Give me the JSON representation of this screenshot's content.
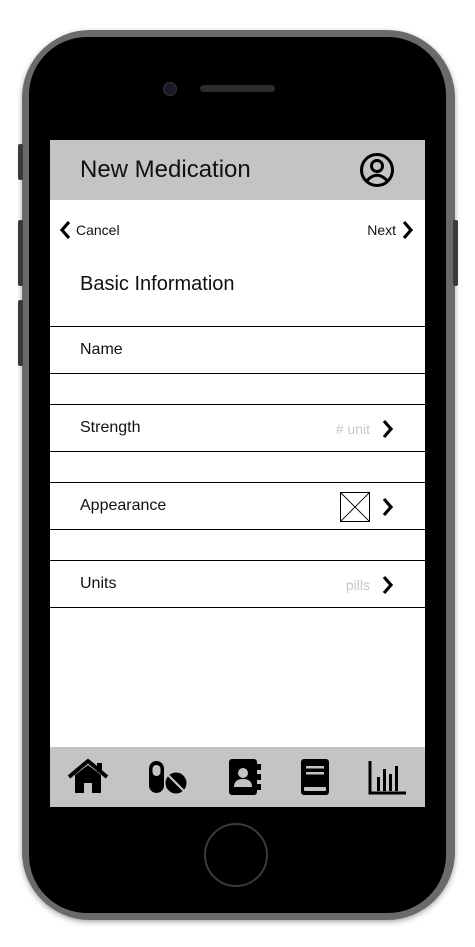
{
  "header": {
    "title": "New Medication",
    "profile_icon": "user-circle-icon"
  },
  "nav": {
    "cancel_label": "Cancel",
    "next_label": "Next"
  },
  "section": {
    "title": "Basic Information"
  },
  "form": {
    "name": {
      "label": "Name"
    },
    "strength": {
      "label": "Strength",
      "hint": "# unit"
    },
    "appearance": {
      "label": "Appearance",
      "image_icon": "image-placeholder-icon"
    },
    "units": {
      "label": "Units",
      "hint": "pills"
    }
  },
  "tabbar": {
    "items": [
      {
        "icon": "home-icon"
      },
      {
        "icon": "pills-icon"
      },
      {
        "icon": "contacts-icon"
      },
      {
        "icon": "book-icon"
      },
      {
        "icon": "chart-icon"
      }
    ]
  },
  "colors": {
    "bar_gray": "#c4c4c4",
    "hint_gray": "#c8c8c8",
    "text": "#111111"
  }
}
